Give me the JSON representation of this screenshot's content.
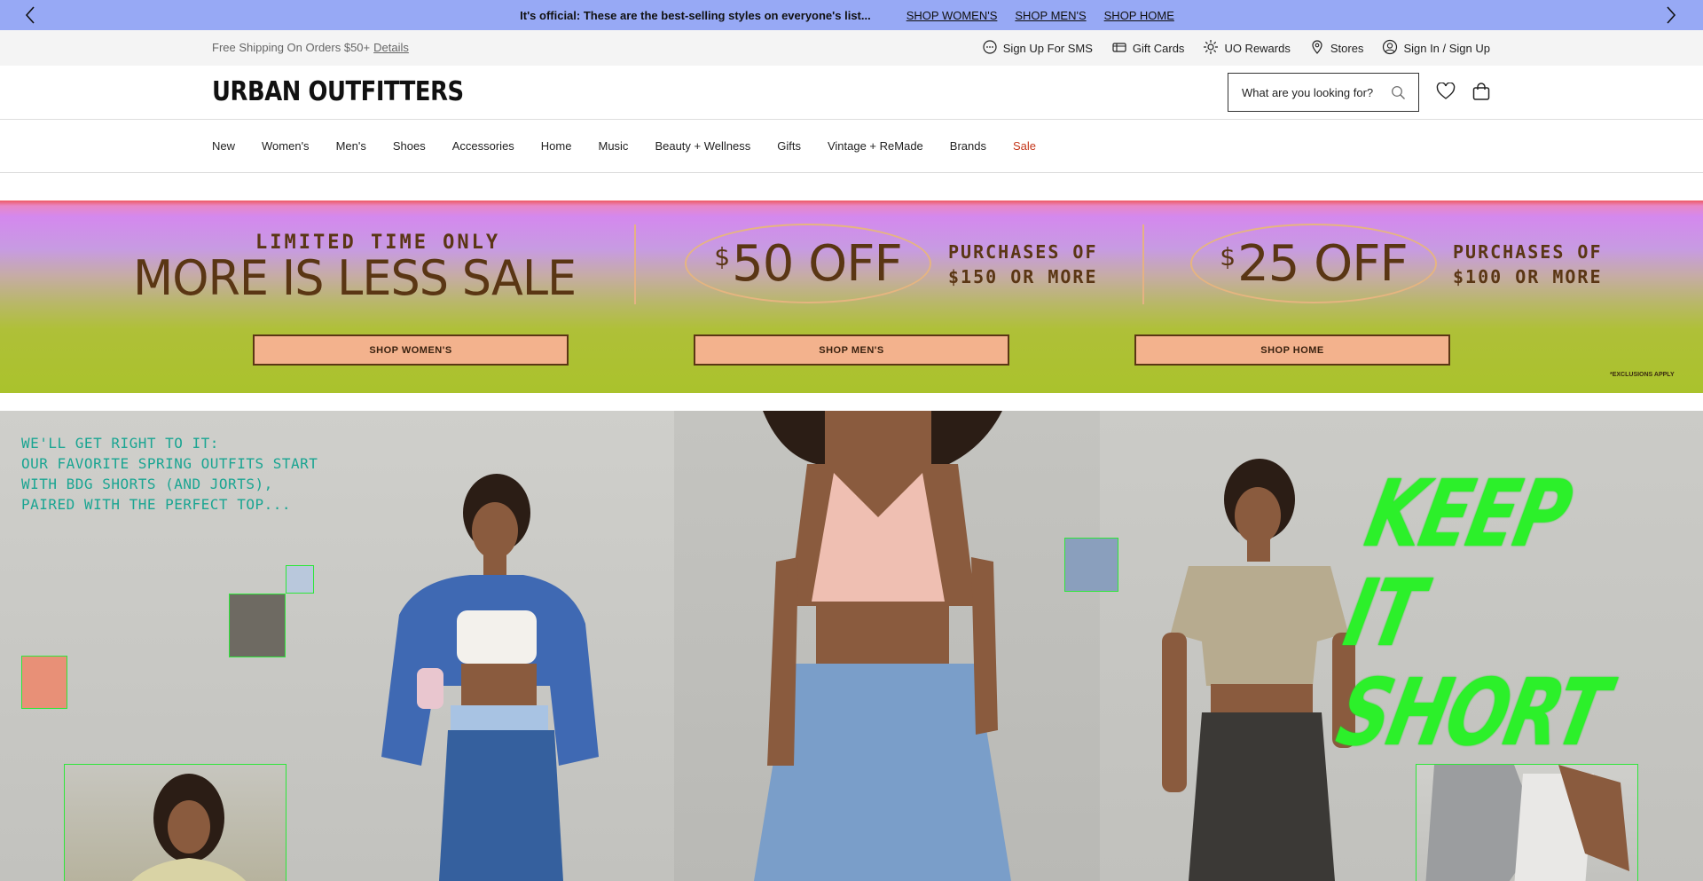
{
  "promo": {
    "message": "It's official: These are the best-selling styles on everyone's list...",
    "links": [
      "SHOP WOMEN'S",
      "SHOP MEN'S",
      "SHOP HOME"
    ]
  },
  "utility": {
    "shipping": "Free Shipping On Orders $50+",
    "details": "Details",
    "items": [
      "Sign Up For SMS",
      "Gift Cards",
      "UO Rewards",
      "Stores",
      "Sign In / Sign Up"
    ]
  },
  "header": {
    "logo": "URBAN OUTFITTERS",
    "search_placeholder": "What are you looking for?"
  },
  "nav": {
    "items": [
      "New",
      "Women's",
      "Men's",
      "Shoes",
      "Accessories",
      "Home",
      "Music",
      "Beauty + Wellness",
      "Gifts",
      "Vintage + ReMade",
      "Brands",
      "Sale"
    ]
  },
  "banner": {
    "kicker": "LIMITED TIME ONLY",
    "title": "MORE IS LESS SALE",
    "offers": [
      {
        "currency": "$",
        "amount": "50 OFF",
        "line1": "PURCHASES OF",
        "line2": "$150 OR MORE"
      },
      {
        "currency": "$",
        "amount": "25 OFF",
        "line1": "PURCHASES OF",
        "line2": "$100 OR MORE"
      }
    ],
    "buttons": [
      "SHOP WOMEN'S",
      "SHOP MEN'S",
      "SHOP HOME"
    ],
    "exclusions": "*EXCLUSIONS APPLY"
  },
  "hero": {
    "lines": [
      "WE'LL GET RIGHT TO IT:",
      "OUR FAVORITE SPRING OUTFITS START",
      "WITH BDG SHORTS (AND JORTS),",
      "PAIRED WITH THE PERFECT TOP..."
    ],
    "headline_1": "KEEP IT",
    "headline_2": "SHORT"
  },
  "colors": {
    "promo_bg": "#97a9f5",
    "sale_red": "#c4361a",
    "banner_text": "#5a3614",
    "button_bg": "#f3b28d",
    "hero_text": "#1aa592",
    "hero_headline": "#2cf02a"
  }
}
